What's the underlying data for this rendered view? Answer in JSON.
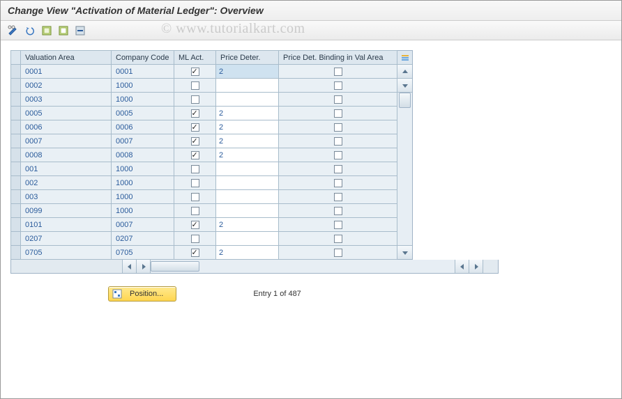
{
  "header": {
    "title": "Change View \"Activation of Material Ledger\": Overview"
  },
  "toolbar": {
    "buttons": [
      {
        "name": "toggle-display-change-icon"
      },
      {
        "name": "undo-icon"
      },
      {
        "name": "select-all-icon"
      },
      {
        "name": "deselect-all-icon"
      },
      {
        "name": "delete-icon"
      }
    ]
  },
  "watermark": "© www.tutorialkart.com",
  "table": {
    "columns": {
      "valuation_area": "Valuation Area",
      "company_code": "Company Code",
      "ml_act": "ML Act.",
      "price_deter": "Price Deter.",
      "price_binding": "Price Det. Binding in Val Area"
    },
    "rows": [
      {
        "valuation_area": "0001",
        "company_code": "0001",
        "ml_act": true,
        "price_deter": "2",
        "pd_selected": true,
        "price_binding": false
      },
      {
        "valuation_area": "0002",
        "company_code": "1000",
        "ml_act": false,
        "price_deter": "",
        "price_binding": false
      },
      {
        "valuation_area": "0003",
        "company_code": "1000",
        "ml_act": false,
        "price_deter": "",
        "price_binding": false
      },
      {
        "valuation_area": "0005",
        "company_code": "0005",
        "ml_act": true,
        "price_deter": "2",
        "price_binding": false
      },
      {
        "valuation_area": "0006",
        "company_code": "0006",
        "ml_act": true,
        "price_deter": "2",
        "price_binding": false
      },
      {
        "valuation_area": "0007",
        "company_code": "0007",
        "ml_act": true,
        "price_deter": "2",
        "price_binding": false
      },
      {
        "valuation_area": "0008",
        "company_code": "0008",
        "ml_act": true,
        "price_deter": "2",
        "price_binding": false
      },
      {
        "valuation_area": "001",
        "company_code": "1000",
        "ml_act": false,
        "price_deter": "",
        "price_binding": false
      },
      {
        "valuation_area": "002",
        "company_code": "1000",
        "ml_act": false,
        "price_deter": "",
        "price_binding": false
      },
      {
        "valuation_area": "003",
        "company_code": "1000",
        "ml_act": false,
        "price_deter": "",
        "price_binding": false
      },
      {
        "valuation_area": "0099",
        "company_code": "1000",
        "ml_act": false,
        "price_deter": "",
        "price_binding": false
      },
      {
        "valuation_area": "0101",
        "company_code": "0007",
        "ml_act": true,
        "price_deter": "2",
        "price_binding": false
      },
      {
        "valuation_area": "0207",
        "company_code": "0207",
        "ml_act": false,
        "price_deter": "",
        "price_binding": false
      },
      {
        "valuation_area": "0705",
        "company_code": "0705",
        "ml_act": true,
        "price_deter": "2",
        "price_binding": false
      }
    ]
  },
  "footer": {
    "position_label": "Position...",
    "entry_text": "Entry 1 of 487"
  }
}
